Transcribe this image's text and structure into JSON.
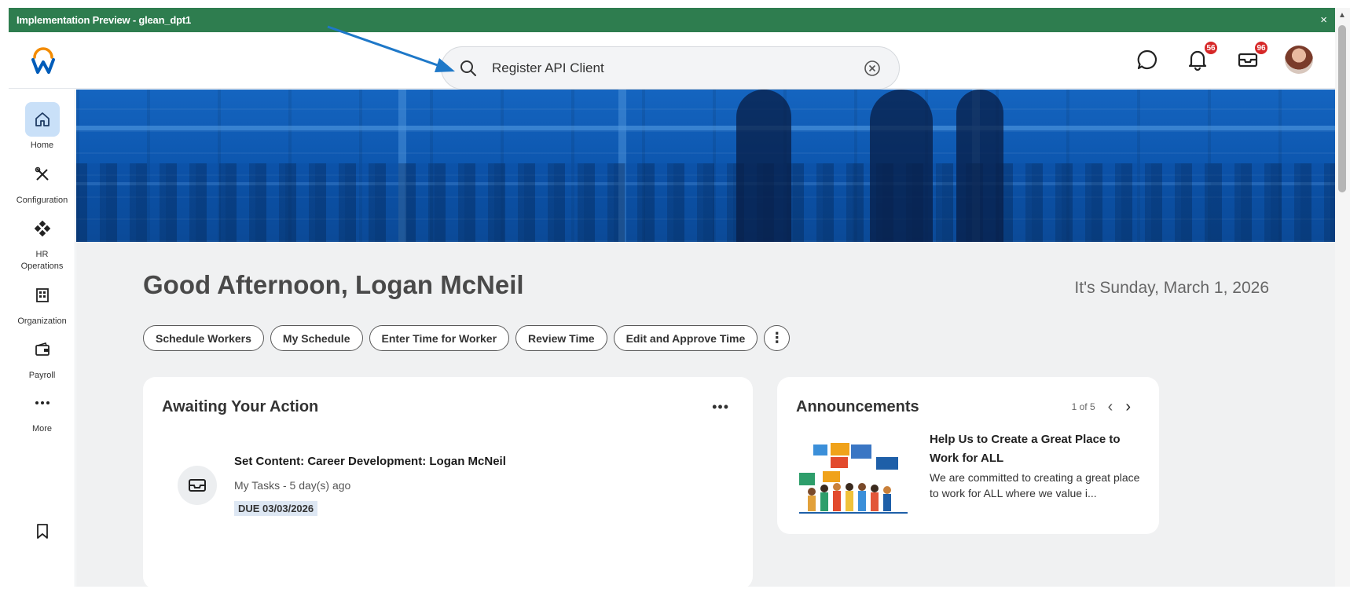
{
  "preview_bar": {
    "title": "Implementation Preview - glean_dpt1",
    "close": "×"
  },
  "search": {
    "value": "Register API Client"
  },
  "notifications": {
    "count": "56"
  },
  "inbox": {
    "count": "96"
  },
  "sidebar": {
    "items": [
      {
        "label": "Home"
      },
      {
        "label": "Configuration"
      },
      {
        "label": "HR\nOperations"
      },
      {
        "label": "Organization"
      },
      {
        "label": "Payroll"
      },
      {
        "label": "More"
      }
    ]
  },
  "main": {
    "greeting": "Good Afternoon, Logan McNeil",
    "date": "It's Sunday, March 1, 2026",
    "quick_actions": [
      "Schedule Workers",
      "My Schedule",
      "Enter Time for Worker",
      "Review Time",
      "Edit and Approve Time"
    ],
    "more_actions": "⋮"
  },
  "awaiting": {
    "title": "Awaiting Your Action",
    "menu": "•••",
    "task": {
      "title": "Set Content: Career Development: Logan McNeil",
      "subtitle": "My Tasks - 5 day(s) ago",
      "due": "DUE 03/03/2026"
    }
  },
  "announcements": {
    "title": "Announcements",
    "pager": "1 of 5",
    "prev": "‹",
    "next": "›",
    "headline": "Help Us to Create a Great Place to Work for ALL",
    "body": "We are committed to creating a great place to work for ALL where we value i..."
  },
  "colors": {
    "preview_bar": "#2e7d4f",
    "banner": "#1565c0",
    "badge": "#d62828",
    "active_nav": "#c9e0f8",
    "annotation_arrow": "#1e78c8"
  }
}
